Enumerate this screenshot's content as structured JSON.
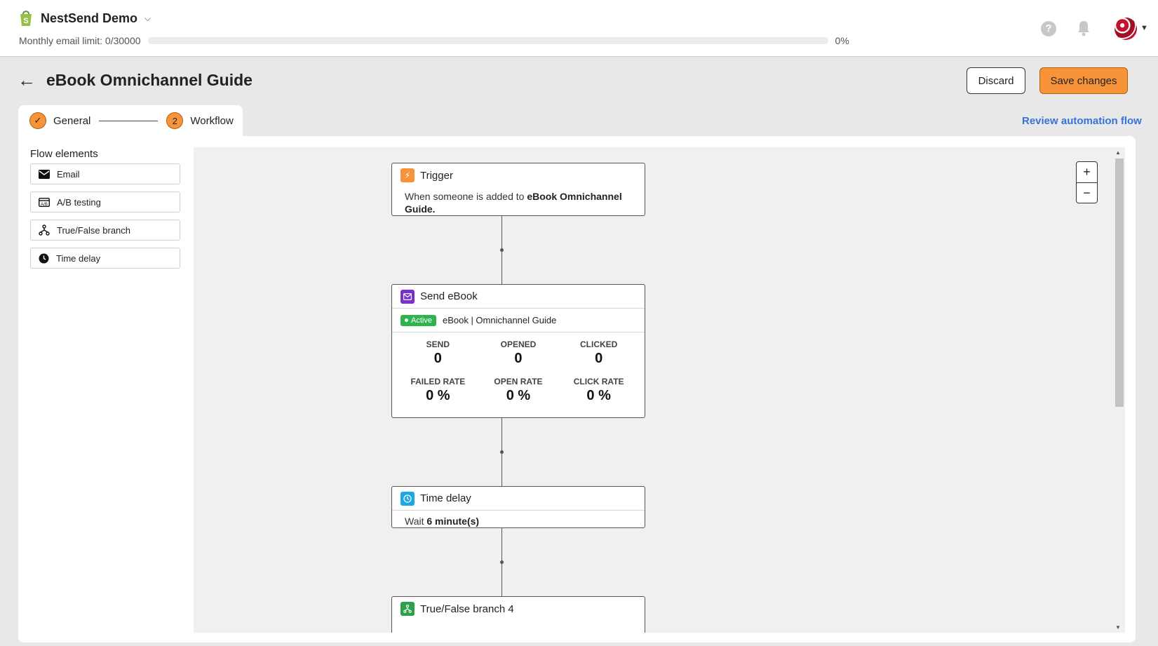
{
  "store": {
    "name": "NestSend Demo"
  },
  "limit": {
    "label": "Monthly email limit: 0/30000",
    "percent_text": "0%",
    "used_fraction": 0
  },
  "header": {
    "title": "eBook Omnichannel Guide",
    "discard": "Discard",
    "save": "Save changes"
  },
  "tabs": {
    "steps": [
      {
        "marker": "✓",
        "label": "General"
      },
      {
        "marker": "2",
        "label": "Workflow"
      }
    ],
    "review_link": "Review automation flow"
  },
  "flow_elements": {
    "title": "Flow elements",
    "items": [
      {
        "label": "Email",
        "icon": "envelope-icon"
      },
      {
        "label": "A/B testing",
        "icon": "ab-testing-icon"
      },
      {
        "label": "True/False branch",
        "icon": "branch-icon"
      },
      {
        "label": "Time delay",
        "icon": "clock-icon"
      }
    ]
  },
  "nodes": {
    "trigger": {
      "title": "Trigger",
      "text_prefix": "When someone is added to ",
      "text_bold": "eBook Omnichannel Guide."
    },
    "email": {
      "title": "Send eBook",
      "status": "Active",
      "subject": "eBook | Omnichannel Guide",
      "stats": [
        {
          "label": "SEND",
          "value": "0"
        },
        {
          "label": "OPENED",
          "value": "0"
        },
        {
          "label": "CLICKED",
          "value": "0"
        },
        {
          "label": "FAILED RATE",
          "value": "0 %"
        },
        {
          "label": "OPEN RATE",
          "value": "0 %"
        },
        {
          "label": "CLICK RATE",
          "value": "0 %"
        }
      ]
    },
    "delay": {
      "title": "Time delay",
      "text_prefix": "Wait ",
      "text_bold": "6 minute(s)"
    },
    "branch": {
      "title": "True/False branch 4"
    }
  },
  "zoom": {
    "in": "+",
    "out": "−"
  },
  "colors": {
    "accent": "#f7943a",
    "link": "#3673d8",
    "active": "#2fb34d",
    "email_icon": "#7b2fd1",
    "trigger_icon": "#f7943a",
    "delay_icon": "#1ea7e4",
    "branch_icon": "#2fa04d"
  }
}
